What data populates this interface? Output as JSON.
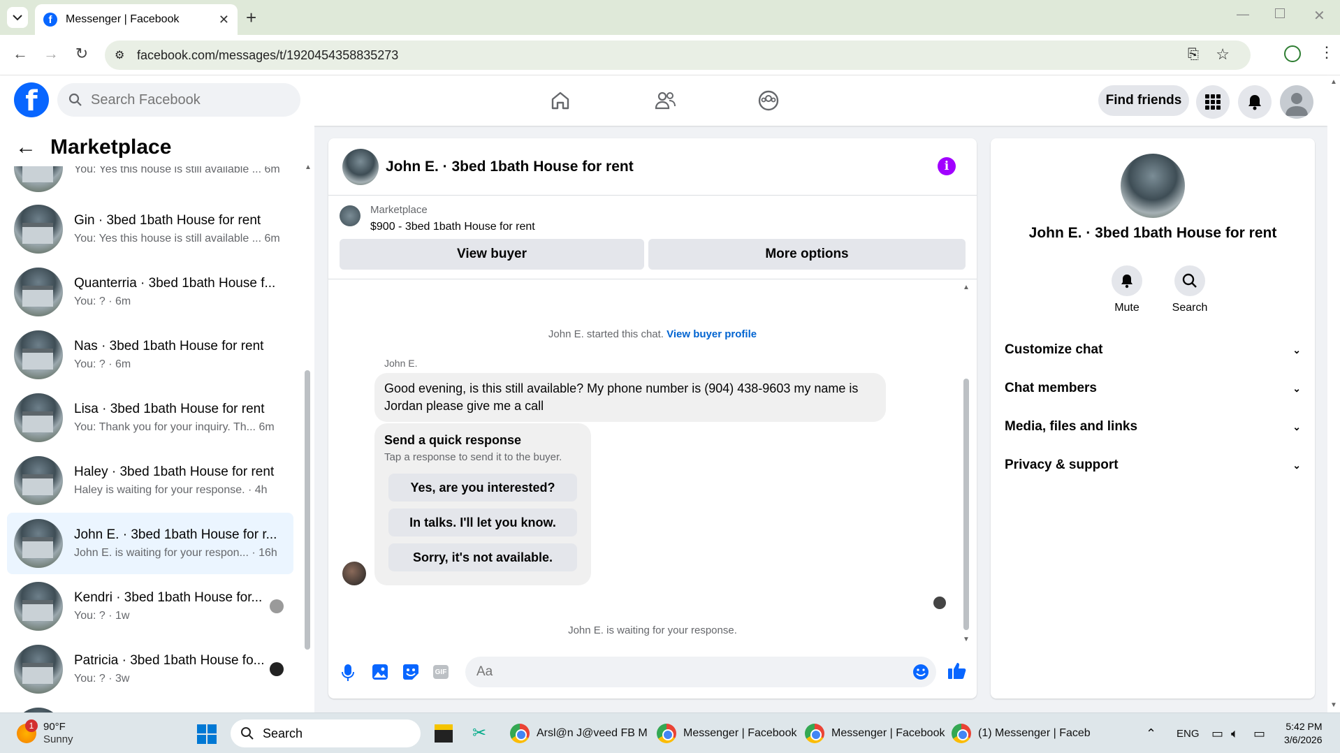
{
  "browser": {
    "tab_title": "Messenger | Facebook",
    "url": "facebook.com/messages/t/1920454358835273"
  },
  "header": {
    "search_placeholder": "Search Facebook",
    "find_friends": "Find friends"
  },
  "sidebar": {
    "title": "Marketplace",
    "conversations": [
      {
        "name": "",
        "preview": "You: Yes this house is still available ...",
        "time": "6m"
      },
      {
        "name": "Gin · 3bed 1bath House for rent",
        "preview": "You: Yes this house is still available ...",
        "time": "6m"
      },
      {
        "name": "Quanterria · 3bed 1bath House f...",
        "preview": "You: ? · 6m",
        "time": ""
      },
      {
        "name": "Nas · 3bed 1bath House for rent",
        "preview": "You: ? · 6m",
        "time": ""
      },
      {
        "name": "Lisa · 3bed 1bath House for rent",
        "preview": "You: Thank you for your inquiry. Th...",
        "time": "6m"
      },
      {
        "name": "Haley · 3bed 1bath House for rent",
        "preview": "Haley is waiting for your response. · 4h",
        "time": ""
      },
      {
        "name": "John E. · 3bed 1bath House for r...",
        "preview": "John E. is waiting for your respon...",
        "time": "· 16h"
      },
      {
        "name": "Kendri · 3bed 1bath House for...",
        "preview": "You: ? · 1w",
        "time": ""
      },
      {
        "name": "Patricia · 3bed 1bath House fo...",
        "preview": "You: ? · 3w",
        "time": ""
      }
    ]
  },
  "chat": {
    "title": "John E. · 3bed 1bath House for rent",
    "listing_source": "Marketplace",
    "listing": "$900 - 3bed 1bath House for rent",
    "view_buyer": "View buyer",
    "more_options": "More options",
    "started": "John E. started this chat.",
    "view_profile": "View buyer profile",
    "sender": "John E.",
    "message_line1": "Good evening, is this still available? My phone number is (904) 438-9603 my name is",
    "message_line2": "Jordan please give me a call",
    "quick_title": "Send a quick response",
    "quick_sub": "Tap a response to send it to the buyer.",
    "quick_responses": [
      "Yes, are you interested?",
      "In talks. I'll let you know.",
      "Sorry, it's not available."
    ],
    "waiting": "John E. is waiting for your response.",
    "composer_placeholder": "Aa"
  },
  "details": {
    "name": "John E. · 3bed 1bath House for rent",
    "mute": "Mute",
    "search": "Search",
    "rows": [
      "Customize chat",
      "Chat members",
      "Media, files and links",
      "Privacy & support"
    ]
  },
  "taskbar": {
    "weather_temp": "90°F",
    "weather_desc": "Sunny",
    "weather_badge": "1",
    "search": "Search",
    "apps": [
      "Arsl@n J@veed FB M",
      "Messenger | Facebook",
      "Messenger | Facebook",
      "(1) Messenger | Faceb"
    ],
    "lang": "ENG",
    "time": "5:42 PM",
    "date": "3/6/2026"
  },
  "colors": {
    "fb_blue": "#0866ff",
    "info_purple": "#a100ff",
    "selected_bg": "#ebf5ff"
  }
}
